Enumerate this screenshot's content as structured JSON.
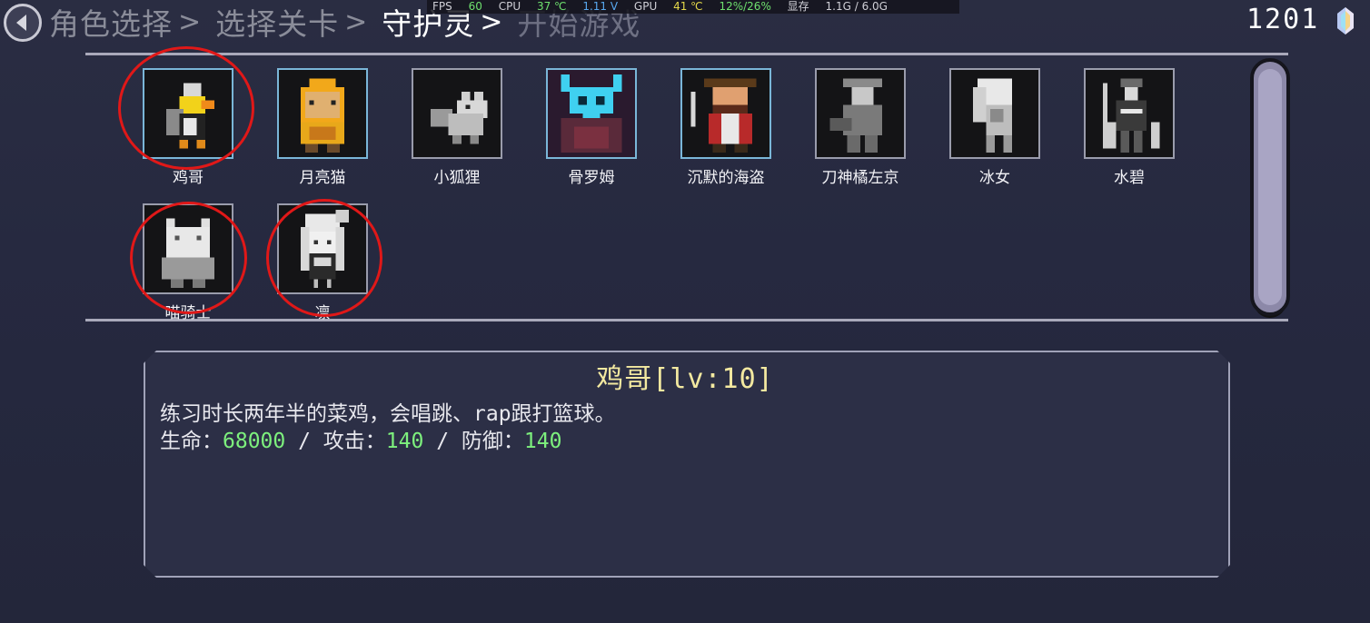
{
  "breadcrumb": {
    "items": [
      {
        "label": "角色选择",
        "state": "past"
      },
      {
        "label": "选择关卡",
        "state": "past"
      },
      {
        "label": "守护灵",
        "state": "current"
      },
      {
        "label": "开始游戏",
        "state": "future"
      }
    ],
    "separator": ">"
  },
  "perf_overlay": {
    "fps_label": "FPS",
    "fps_value": "60",
    "cpu_label": "CPU",
    "cpu_temp": "37 ℃",
    "cpu_volt": "1.11 V",
    "gpu_label": "GPU",
    "gpu_temp": "41 ℃",
    "gpu_usage": "12%/26%",
    "vram_label": "显存",
    "vram_value": "1.1G / 6.0G"
  },
  "currency": {
    "amount": "1201",
    "icon": "crystal-icon"
  },
  "characters": [
    {
      "name": "鸡哥",
      "selected": true,
      "unlocked": true,
      "icon": "chicken-portrait"
    },
    {
      "name": "月亮猫",
      "selected": false,
      "unlocked": true,
      "icon": "moon-cat-portrait"
    },
    {
      "name": "小狐狸",
      "selected": false,
      "unlocked": false,
      "icon": "fox-portrait"
    },
    {
      "name": "骨罗姆",
      "selected": false,
      "unlocked": true,
      "icon": "bone-rom-portrait"
    },
    {
      "name": "沉默的海盗",
      "selected": false,
      "unlocked": true,
      "icon": "pirate-portrait"
    },
    {
      "name": "刀神橘左京",
      "selected": false,
      "unlocked": false,
      "icon": "swordsman-portrait"
    },
    {
      "name": "冰女",
      "selected": false,
      "unlocked": false,
      "icon": "ice-girl-portrait"
    },
    {
      "name": "水碧",
      "selected": false,
      "unlocked": false,
      "icon": "shuibi-portrait"
    },
    {
      "name": "喵骑士",
      "selected": false,
      "unlocked": false,
      "icon": "cat-knight-portrait"
    },
    {
      "name": "凛",
      "selected": false,
      "unlocked": false,
      "icon": "rin-portrait"
    }
  ],
  "detail": {
    "title": "鸡哥[lv:10]",
    "description": "练习时长两年半的菜鸡，会唱跳、rap跟打篮球。",
    "hp_label": "生命：",
    "hp_value": "68000",
    "atk_label": " / 攻击：",
    "atk_value": "140",
    "def_label": " / 防御：",
    "def_value": "140"
  },
  "colors": {
    "background": "#262940",
    "title_yellow": "#f3e9a0",
    "stat_green": "#7df07d",
    "highlight_red": "#e01818"
  }
}
